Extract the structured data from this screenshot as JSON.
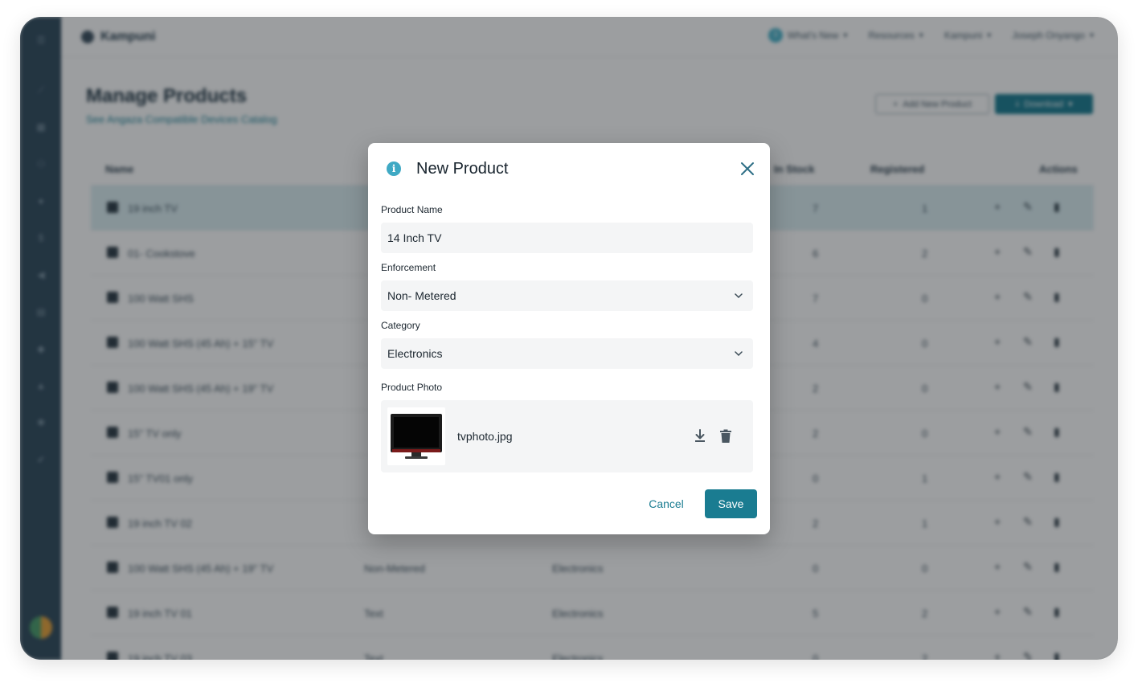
{
  "app": {
    "brand": "Kampuni",
    "nav": [
      {
        "label": "What's New",
        "badge": "3"
      },
      {
        "label": "Resources"
      },
      {
        "label": "Kampuni"
      },
      {
        "label": "Joseph Onyango"
      }
    ]
  },
  "page": {
    "title": "Manage Products",
    "link": "See Angaza Compatible Devices Catalog",
    "add_button": "Add New Product",
    "download_button": "Download"
  },
  "table": {
    "headers": [
      "Name",
      "In Stock",
      "Registered",
      "Actions"
    ],
    "rows": [
      {
        "name": "19 inch TV",
        "enforcement": "",
        "category": "",
        "in_stock": "7",
        "registered": "1"
      },
      {
        "name": "01- Cookstove",
        "enforcement": "",
        "category": "",
        "in_stock": "6",
        "registered": "2"
      },
      {
        "name": "100 Watt SHS",
        "enforcement": "",
        "category": "",
        "in_stock": "7",
        "registered": "0"
      },
      {
        "name": "100 Watt SHS (45 Ah) + 15\" TV",
        "enforcement": "",
        "category": "",
        "in_stock": "4",
        "registered": "0"
      },
      {
        "name": "100 Watt SHS (45 Ah) + 19\" TV",
        "enforcement": "",
        "category": "",
        "in_stock": "2",
        "registered": "0"
      },
      {
        "name": "15\" TV only",
        "enforcement": "",
        "category": "",
        "in_stock": "2",
        "registered": "0"
      },
      {
        "name": "15\" TV01 only",
        "enforcement": "",
        "category": "",
        "in_stock": "0",
        "registered": "1"
      },
      {
        "name": "19 inch TV 02",
        "enforcement": "",
        "category": "",
        "in_stock": "2",
        "registered": "1"
      },
      {
        "name": "100 Watt SHS (45 Ah) + 19\" TV",
        "enforcement": "Non-Metered",
        "category": "Electronics",
        "in_stock": "0",
        "registered": "0"
      },
      {
        "name": "19 inch TV 01",
        "enforcement": "Text",
        "category": "Electronics",
        "in_stock": "5",
        "registered": "2"
      },
      {
        "name": "19 inch TV 03",
        "enforcement": "Text",
        "category": "Electronics",
        "in_stock": "0",
        "registered": "2"
      }
    ]
  },
  "modal": {
    "title": "New Product",
    "product_name": {
      "label": "Product Name",
      "value": "14 Inch TV"
    },
    "enforcement": {
      "label": "Enforcement",
      "value": "Non- Metered"
    },
    "category": {
      "label": "Category",
      "value": "Electronics"
    },
    "photo": {
      "label": "Product Photo",
      "filename": "tvphoto.jpg"
    },
    "cancel_label": "Cancel",
    "save_label": "Save"
  },
  "colors": {
    "accent": "#1a7c91",
    "info": "#3fa9c4",
    "sidebar": "#2f4a5c"
  }
}
